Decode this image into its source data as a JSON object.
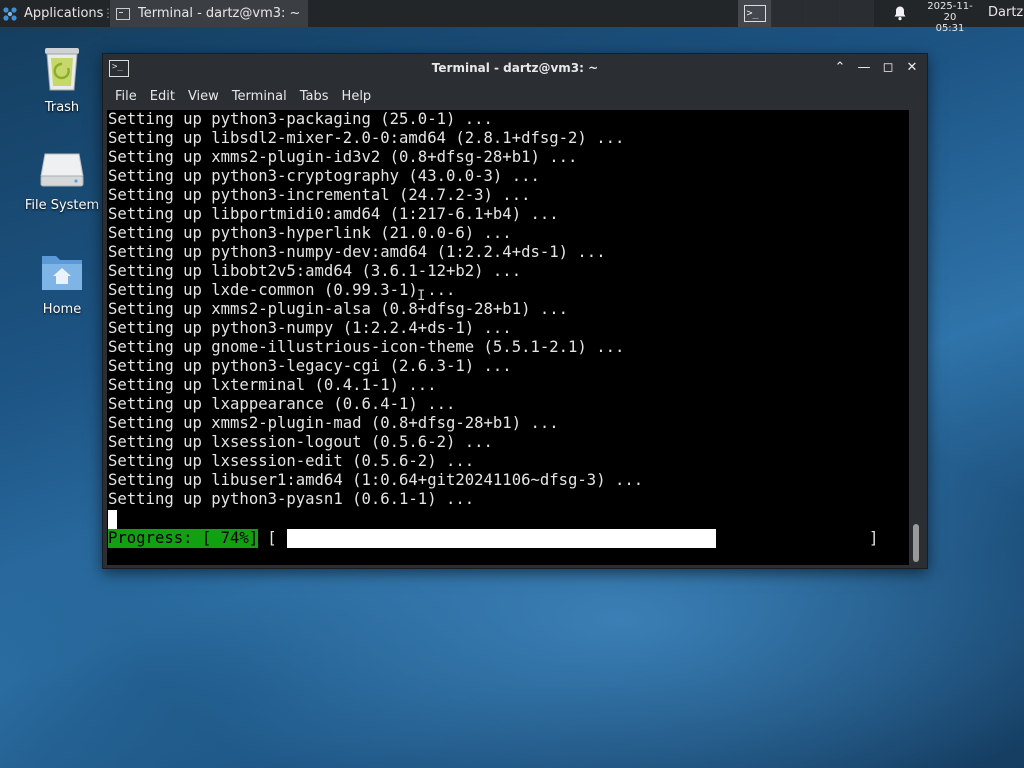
{
  "panel": {
    "applications_label": "Applications",
    "separator": "⋮",
    "task_title": "Terminal - dartz@vm3: ~",
    "clock_date": "2025-11-20",
    "clock_time": "05:31",
    "user": "Dartz",
    "workspace_glyph": ">_"
  },
  "desktop": {
    "icons": [
      {
        "label": "Trash",
        "icon": "trash-icon"
      },
      {
        "label": "File System",
        "icon": "drive-icon"
      },
      {
        "label": "Home",
        "icon": "home-folder-icon"
      }
    ]
  },
  "window": {
    "title": "Terminal - dartz@vm3: ~",
    "icon_glyph": ">_",
    "buttons": {
      "shade": "⌃",
      "minimize": "—",
      "maximize": "◻",
      "close": "✕"
    },
    "menu": [
      "File",
      "Edit",
      "View",
      "Terminal",
      "Tabs",
      "Help"
    ]
  },
  "terminal": {
    "lines": [
      "Setting up python3-packaging (25.0-1) ...",
      "Setting up libsdl2-mixer-2.0-0:amd64 (2.8.1+dfsg-2) ...",
      "Setting up xmms2-plugin-id3v2 (0.8+dfsg-28+b1) ...",
      "Setting up python3-cryptography (43.0.0-3) ...",
      "Setting up python3-incremental (24.7.2-3) ...",
      "Setting up libportmidi0:amd64 (1:217-6.1+b4) ...",
      "Setting up python3-hyperlink (21.0.0-6) ...",
      "Setting up python3-numpy-dev:amd64 (1:2.2.4+ds-1) ...",
      "Setting up libobt2v5:amd64 (3.6.1-12+b2) ...",
      "Setting up lxde-common (0.99.3-1) ...",
      "Setting up xmms2-plugin-alsa (0.8+dfsg-28+b1) ...",
      "Setting up python3-numpy (1:2.2.4+ds-1) ...",
      "Setting up gnome-illustrious-icon-theme (5.5.1-2.1) ...",
      "Setting up python3-legacy-cgi (2.6.3-1) ...",
      "Setting up lxterminal (0.4.1-1) ...",
      "Setting up lxappearance (0.6.4-1) ...",
      "Setting up xmms2-plugin-mad (0.8+dfsg-28+b1) ...",
      "Setting up lxsession-logout (0.5.6-2) ...",
      "Setting up lxsession-edit (0.5.6-2) ...",
      "Setting up libuser1:amd64 (1:0.64+git20241106~dfsg-3) ...",
      "Setting up python3-pyasn1 (0.6.1-1) ..."
    ],
    "progress_label": "Progress: [ 74%]",
    "progress_percent": 74,
    "bracket_open": "[",
    "bracket_close": "]"
  },
  "colors": {
    "progress_label_bg": "#11a011",
    "terminal_bg": "#000000",
    "terminal_fg": "#e5e5e5"
  }
}
